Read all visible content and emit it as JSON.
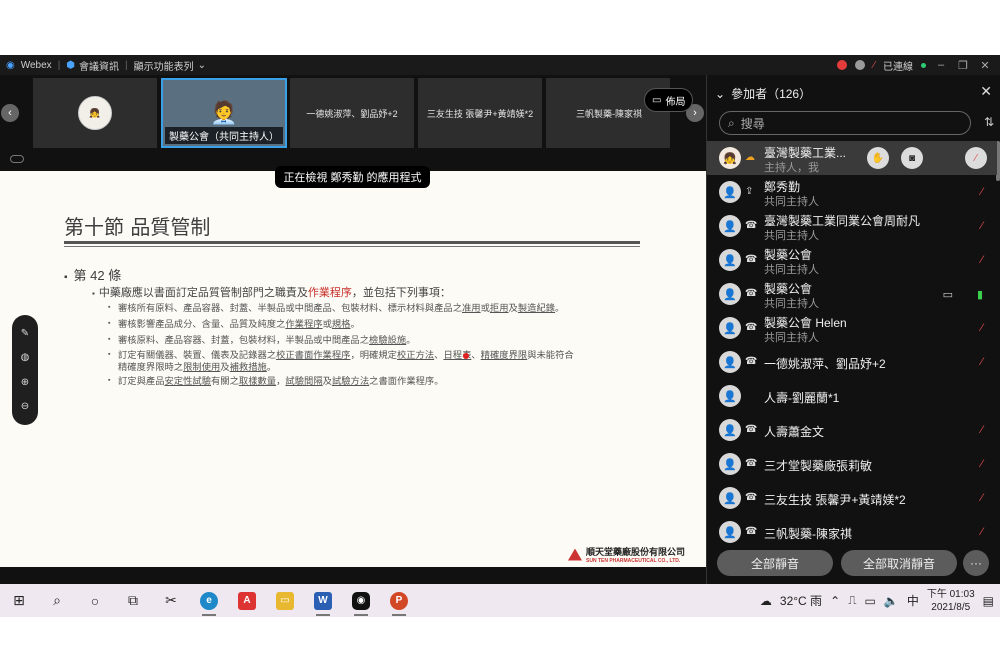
{
  "titlebar": {
    "app": "Webex",
    "meeting_info": "會議資訊",
    "display_list": "顯示功能表列",
    "status": "已連線"
  },
  "strip": {
    "tiles": [
      {
        "label": ""
      },
      {
        "label": "製藥公會（共同主持人）"
      },
      {
        "label": "一德姚淑萍、劉品妤+2"
      },
      {
        "label": "三友生技 張馨尹+黃靖媄*2"
      },
      {
        "label": "三帆製藥-陳家祺"
      }
    ],
    "layout_label": "佈局"
  },
  "banner": "正在檢視 鄭秀勤 的應用程式",
  "slide": {
    "title": "第十節 品質管制",
    "article": "第 42 條",
    "line1_a": "中藥廠應以書面訂定品質管制部門之職責及",
    "line1_red": "作業程序",
    "line1_b": "，並包括下列事項：",
    "items": [
      [
        "審核所有原料、產品容器、封蓋、半製品或中間產品、包裝材料、標示材料與產品之",
        "准用",
        "或",
        "拒用",
        "及",
        "製造紀錄",
        "。"
      ],
      [
        "審核影響產品成分、含量、品質及純度之",
        "作業程序",
        "或",
        "規格",
        "。"
      ],
      [
        "審核原料、產品容器、封蓋，包裝材料，半製品或中間產品之",
        "檢驗設施",
        "。"
      ],
      [
        "訂定有關儀器、裝置、儀表及記錄器之",
        "校正書面作業程序",
        "，明確規定",
        "校正方法",
        "、",
        "日程表",
        "、",
        "精確度界限",
        "與未能符合"
      ],
      [
        "精確度界限時之",
        "限制使用",
        "及",
        "補救措施",
        "。"
      ],
      [
        "訂定與產品",
        "安定性試驗",
        "有關之",
        "取樣數量",
        "，",
        "試驗間隔",
        "及",
        "試驗方法",
        "之書面作業程序。"
      ]
    ],
    "company_zh": "順天堂藥廠股份有限公司",
    "company_en": "SUN TEN PHARMACEUTICAL CO., LTD."
  },
  "panel": {
    "title": "參加者（126）",
    "search_placeholder": "搜尋",
    "participants": [
      {
        "name": "臺灣製藥工業...",
        "role": "主持人，我",
        "mic": "muted"
      },
      {
        "name": "鄭秀勤",
        "role": "共同主持人",
        "mic": "muted"
      },
      {
        "name": "臺灣製藥工業同業公會周耐凡",
        "role": "共同主持人",
        "mic": "muted"
      },
      {
        "name": "製藥公會",
        "role": "共同主持人",
        "mic": "muted"
      },
      {
        "name": "製藥公會",
        "role": "共同主持人",
        "mic": "on"
      },
      {
        "name": "製藥公會 Helen",
        "role": "共同主持人",
        "mic": "muted"
      },
      {
        "name": "一德姚淑萍、劉品妤+2",
        "role": "",
        "mic": "muted"
      },
      {
        "name": "人壽-劉麗蘭*1",
        "role": "",
        "mic": "none"
      },
      {
        "name": "人壽蕭金文",
        "role": "",
        "mic": "muted"
      },
      {
        "name": "三才堂製藥廠張莉敏",
        "role": "",
        "mic": "muted"
      },
      {
        "name": "三友生技 張馨尹+黃靖媄*2",
        "role": "",
        "mic": "muted"
      },
      {
        "name": "三帆製藥-陳家祺",
        "role": "",
        "mic": "muted"
      }
    ],
    "mute_all": "全部靜音",
    "unmute_all": "全部取消靜音"
  },
  "taskbar": {
    "weather": "32°C 雨",
    "ime": "中",
    "time": "下午 01:03",
    "date": "2021/8/5"
  }
}
